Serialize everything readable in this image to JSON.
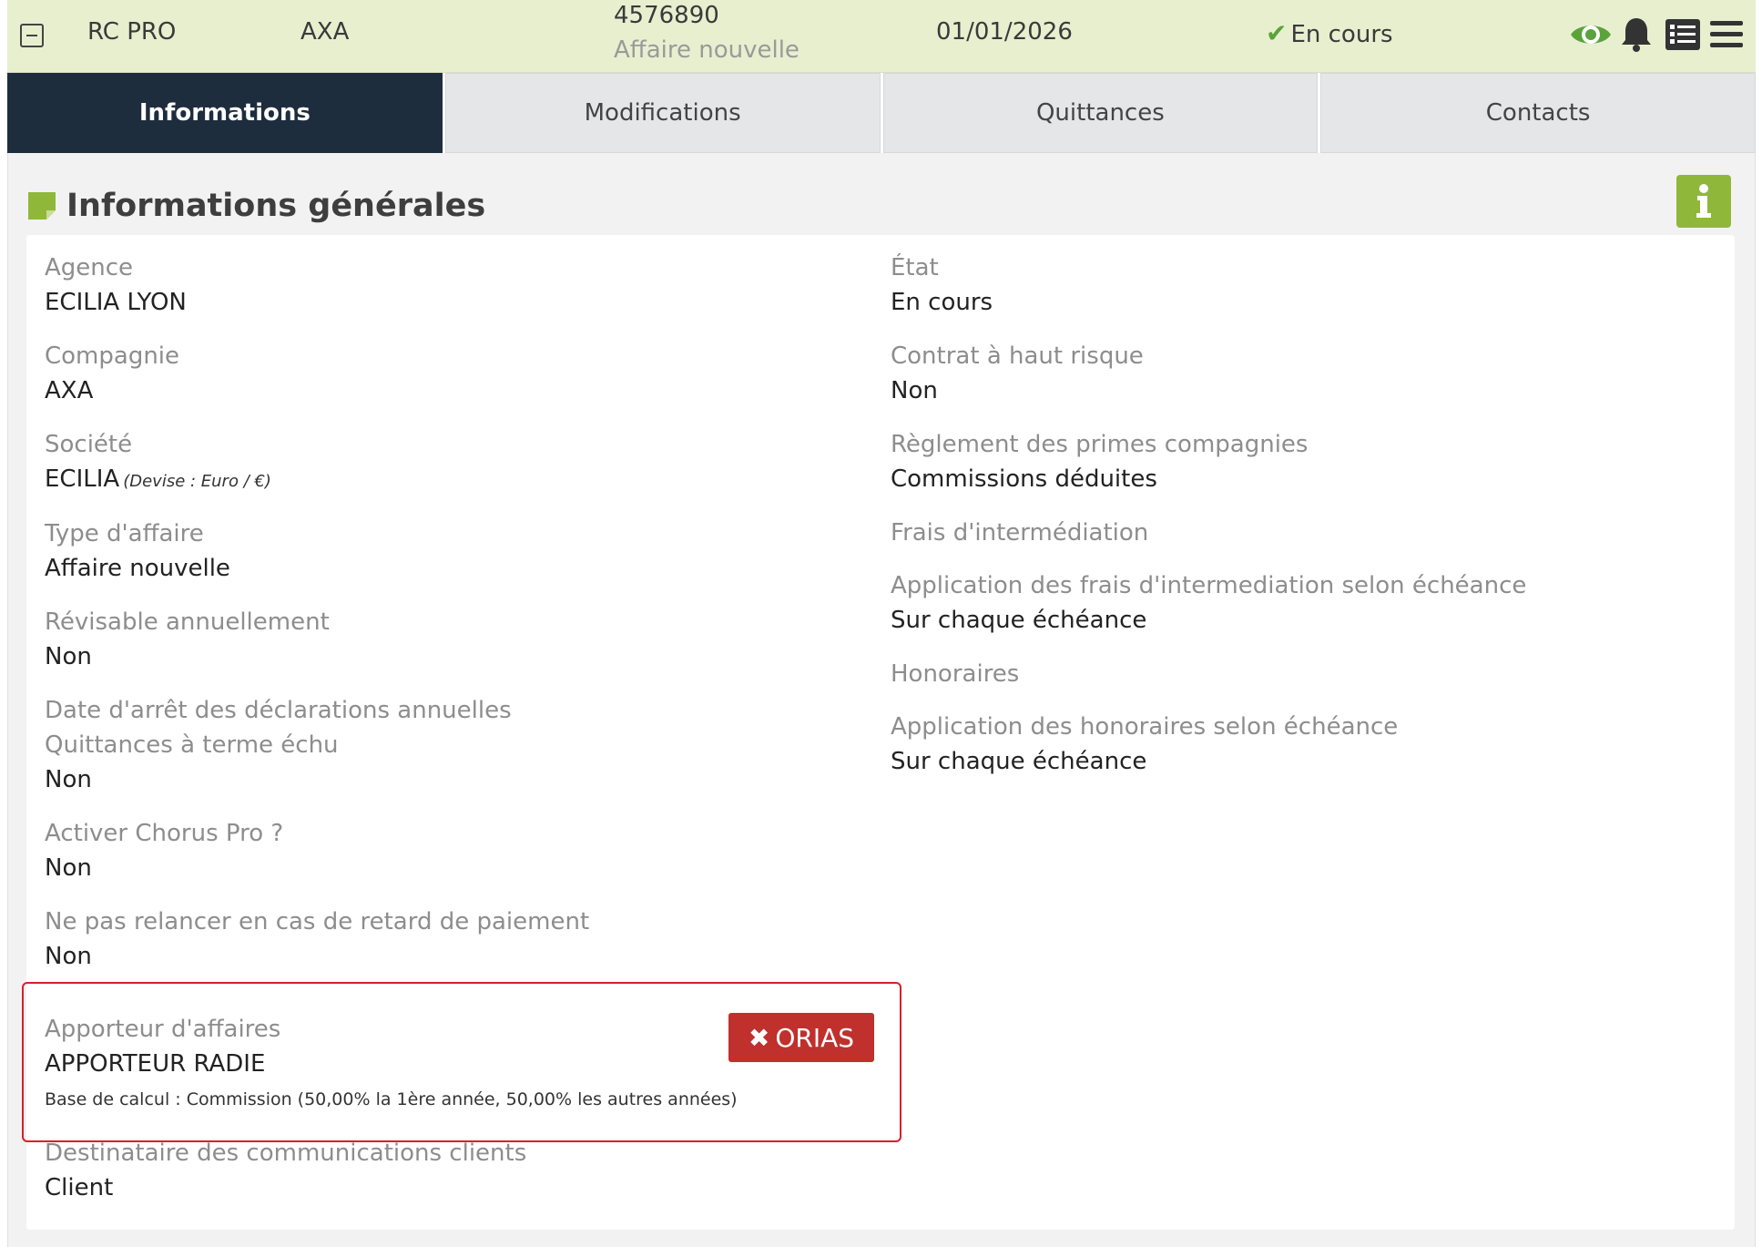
{
  "header": {
    "product": "RC PRO",
    "company": "AXA",
    "contract_number": "4576890",
    "business_type": "Affaire nouvelle",
    "date": "01/01/2026",
    "status": "En cours",
    "icons": [
      "collapse-icon",
      "eye-icon",
      "bell-icon",
      "list-icon",
      "menu-icon"
    ],
    "colors": {
      "bar": "#e8efcf",
      "status_check": "#5aa33a",
      "eye": "#5aa33a"
    }
  },
  "tabs": [
    {
      "label": "Informations",
      "active": true
    },
    {
      "label": "Modifications",
      "active": false
    },
    {
      "label": "Quittances",
      "active": false
    },
    {
      "label": "Contacts",
      "active": false
    }
  ],
  "section": {
    "title": "Informations générales",
    "info_icon": "info-icon",
    "accent": "#8fb83a"
  },
  "left_fields": {
    "agence": {
      "label": "Agence",
      "value": "ECILIA LYON"
    },
    "compagnie": {
      "label": "Compagnie",
      "value": "AXA"
    },
    "societe": {
      "label": "Société",
      "value": "ECILIA",
      "note": "(Devise : Euro / €)"
    },
    "type_affaire": {
      "label": "Type d'affaire",
      "value": "Affaire nouvelle"
    },
    "revisable": {
      "label": "Révisable annuellement",
      "value": "Non"
    },
    "date_arret": {
      "label": "Date d'arrêt des déclarations annuelles"
    },
    "terme_echu": {
      "label": "Quittances à terme échu",
      "value": "Non"
    },
    "chorus": {
      "label": "Activer Chorus Pro ?",
      "value": "Non"
    },
    "relance": {
      "label": "Ne pas relancer en cas de retard de paiement",
      "value": "Non"
    },
    "apporteur": {
      "label": "Apporteur d'affaires",
      "value": "APPORTEUR RADIE",
      "detail": "Base de calcul : Commission (50,00% la 1ère année, 50,00% les autres années)",
      "button": "ORIAS"
    },
    "destinataire": {
      "label": "Destinataire des communications clients",
      "value": "Client"
    }
  },
  "right_fields": {
    "etat": {
      "label": "État",
      "value": "En cours"
    },
    "haut_risque": {
      "label": "Contrat à haut risque",
      "value": "Non"
    },
    "reglement": {
      "label": "Règlement des primes compagnies",
      "value": "Commissions déduites"
    },
    "frais": {
      "label": "Frais d'intermédiation"
    },
    "application_frais": {
      "label": "Application des frais d'intermediation selon échéance",
      "value": "Sur chaque échéance"
    },
    "honoraires": {
      "label": "Honoraires"
    },
    "application_honoraires": {
      "label": "Application des honoraires selon échéance",
      "value": "Sur chaque échéance"
    }
  }
}
